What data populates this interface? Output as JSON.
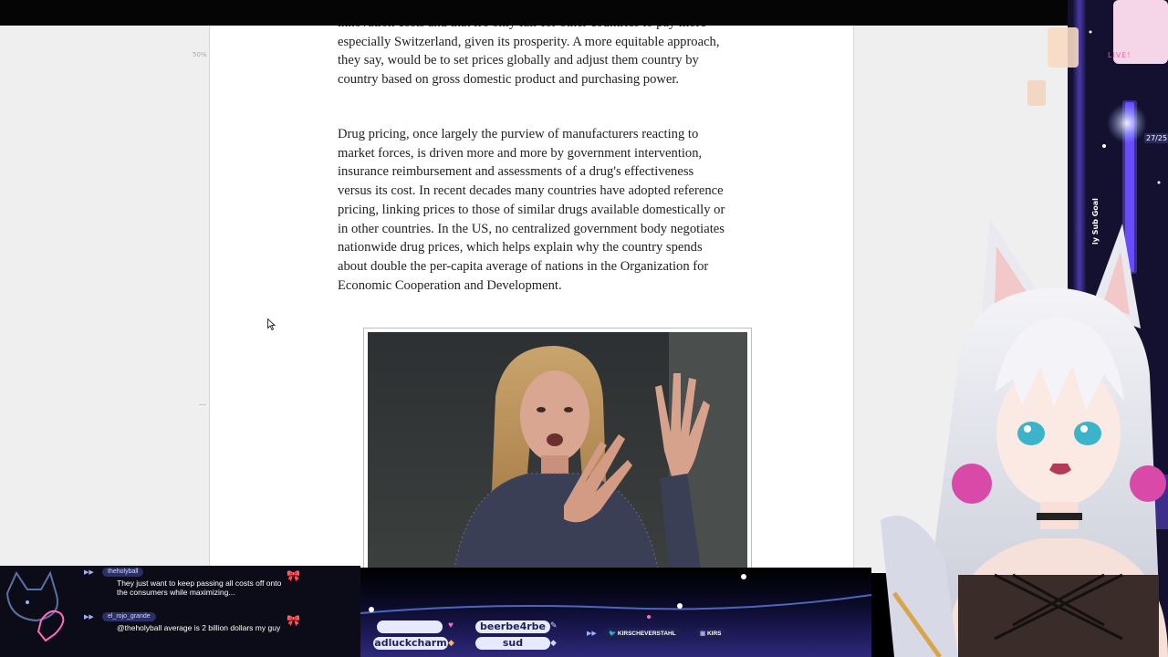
{
  "article": {
    "ruler_label": "50%",
    "paragraph_top": "innovation costs and that it's only fair for other countries to pay more—especially Switzerland, given its prosperity. A more equitable approach, they say, would be to set prices globally and adjust them country by country based on gross domestic product and purchasing power.",
    "paragraph_drug": "Drug pricing, once largely the purview of manufacturers reacting to market forces, is driven more and more by government intervention, insurance reimbursement and assessments of a drug's effectiveness versus its cost. In recent decades many countries have adopted reference pricing, linking prices to those of similar drugs available domestically or in other countries. In the US, no centralized government body negotiates nationwide drug prices, which helps explain why the country spends about double the per-capita average of nations in the Organization for Economic Cooperation and Development."
  },
  "overlay": {
    "live_badge": "LIVE!",
    "sub_count": "27/25",
    "sub_goal_label": "ly Sub Goal"
  },
  "chat": {
    "messages": [
      {
        "user": "theholyball",
        "text": "They just want to keep passing all costs off onto the consumers while maximizing..."
      },
      {
        "user": "el_rojo_grande",
        "text": "@theholyball average is 2 billion dollars my guy"
      }
    ]
  },
  "alerts": {
    "names": [
      "beerbe4rbe",
      "adluckcharm",
      "sud"
    ],
    "socials": [
      {
        "icon": "twitter-icon",
        "label": "KIRSCHEVERSTAHL"
      },
      {
        "icon": "twitch-icon",
        "label": "KIRS"
      }
    ]
  },
  "colors": {
    "page_background": "#efefef",
    "article_background": "#ffffff",
    "text": "#222222",
    "accent_purple": "#6a4cff",
    "accent_pink": "#ff4fa8"
  }
}
